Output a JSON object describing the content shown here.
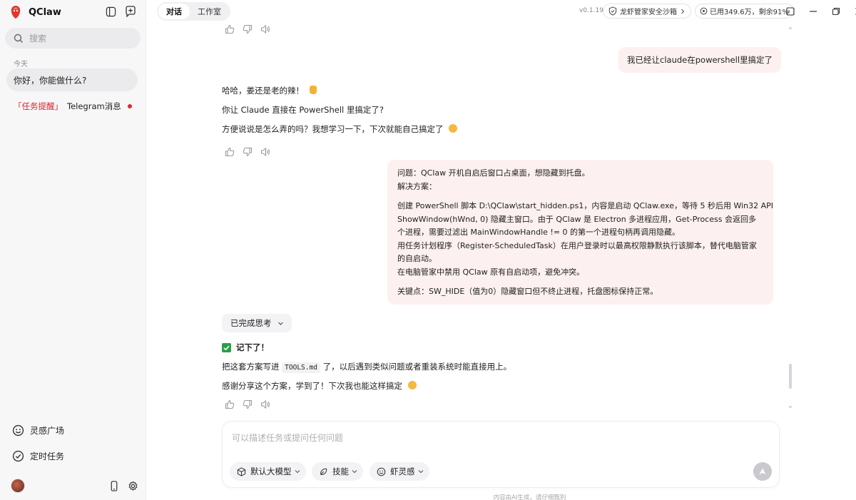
{
  "app": {
    "name": "QClaw",
    "version": "v0.1.19"
  },
  "sidebar": {
    "search_placeholder": "搜索",
    "section_today": "今天",
    "active_conversation": "你好，你能做什么?",
    "task_item": {
      "tag": "「任务提醒」",
      "text": "Telegram消息"
    },
    "links": [
      {
        "label": "灵感广场"
      },
      {
        "label": "定时任务"
      }
    ]
  },
  "topbar": {
    "tabs": [
      {
        "label": "对话"
      },
      {
        "label": "工作室"
      }
    ],
    "sandbox_label": "龙虾管家安全沙箱",
    "usage_label": "已用349.6万，剩余91%"
  },
  "chat": {
    "user_msg_1": "我已经让claude在powershell里搞定了",
    "bot_msg_1": {
      "line1": "哈哈，姜还是老的辣！",
      "line2": "你让 Claude 直接在 PowerShell 里搞定了?",
      "line3": "方便说说是怎么弄的吗？我想学习一下，下次就能自己搞定了"
    },
    "user_msg_2": {
      "problem": "问题：QClaw 开机自启后窗口占桌面，想隐藏到托盘。",
      "solution_title": "解决方案：",
      "p1a": "创建 PowerShell 脚本 D:\\QClaw\\start_hidden.ps1，内容是启动 QClaw.exe，等待 5 秒后用 Win32 API",
      "p1b": "ShowWindow(hWnd, 0) 隐藏主窗口。由于 QClaw 是 Electron 多进程应用，Get-Process 会返回多",
      "p1c": "个进程，需要过滤出 MainWindowHandle != 0 的第一个进程句柄再调用隐藏。",
      "p2a": "用任务计划程序（Register-ScheduledTask）在用户登录时以最高权限静默执行该脚本，替代电脑管家",
      "p2b": "的自启动。",
      "p3": "在电脑管家中禁用 QClaw 原有自启动项，避免冲突。",
      "key": "关键点：SW_HIDE（值为0）隐藏窗口但不终止进程，托盘图标保持正常。"
    },
    "thinking_label": "已完成思考",
    "bot_msg_2": {
      "heading": "记下了！",
      "line1_pre": "把这套方案写进",
      "line1_code": "TOOLS.md",
      "line1_post": "了，以后遇到类似问题或者重装系统时能直接用上。",
      "line2": "感谢分享这个方案，学到了！下次我也能这样搞定"
    }
  },
  "composer": {
    "placeholder": "可以描述任务或提问任何问题",
    "chips": [
      {
        "label": "默认大模型"
      },
      {
        "label": "技能"
      },
      {
        "label": "虾灵感"
      }
    ]
  },
  "footer_note": "内容由AI生成，请仔细甄别",
  "colors": {
    "accent_red": "#d3262b",
    "user_bubble": "#fdf0f0",
    "check_green": "#27a046"
  }
}
